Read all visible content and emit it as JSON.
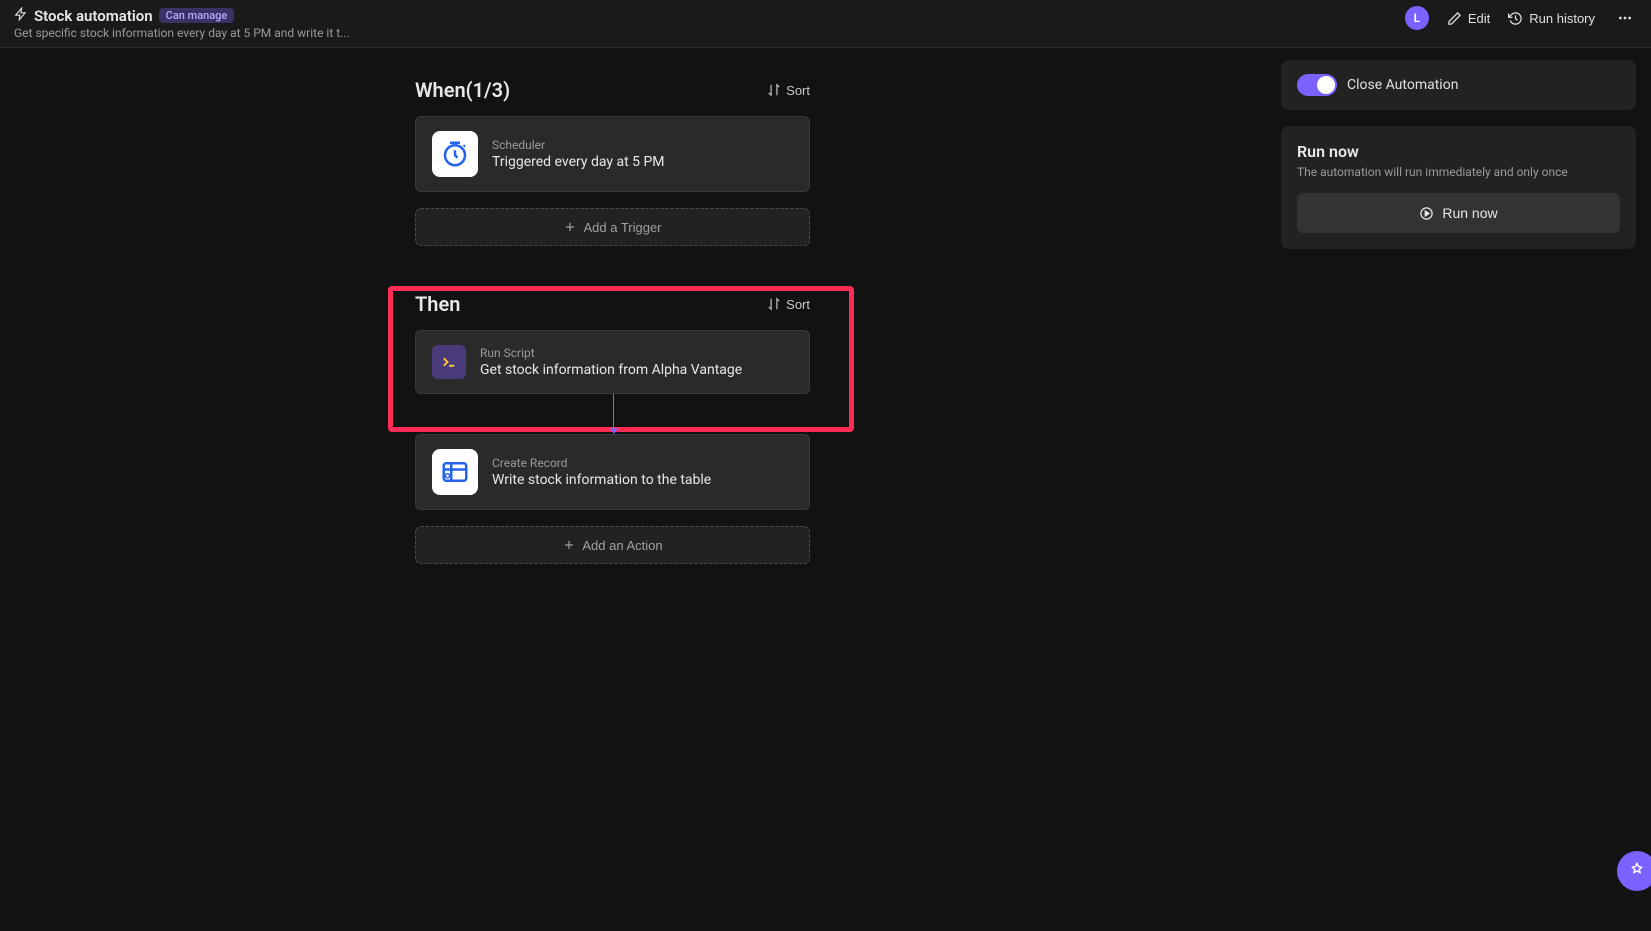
{
  "header": {
    "title": "Stock automation",
    "badge": "Can manage",
    "subtitle": "Get specific stock information every day at 5 PM and write it t...",
    "avatar_letter": "L",
    "edit_label": "Edit",
    "history_label": "Run history"
  },
  "flow": {
    "when": {
      "title": "When(1/3)",
      "sort_label": "Sort",
      "trigger": {
        "type": "Scheduler",
        "desc": "Triggered every day at 5 PM"
      },
      "add_label": "Add a Trigger"
    },
    "then": {
      "title": "Then",
      "sort_label": "Sort",
      "actions": [
        {
          "type": "Run Script",
          "desc": "Get stock information from Alpha Vantage"
        },
        {
          "type": "Create Record",
          "desc": "Write stock information to the table"
        }
      ],
      "add_label": "Add an Action"
    }
  },
  "side": {
    "close_label": "Close Automation",
    "run_now_title": "Run now",
    "run_now_sub": "The automation will run immediately and only once",
    "run_now_btn": "Run now"
  }
}
